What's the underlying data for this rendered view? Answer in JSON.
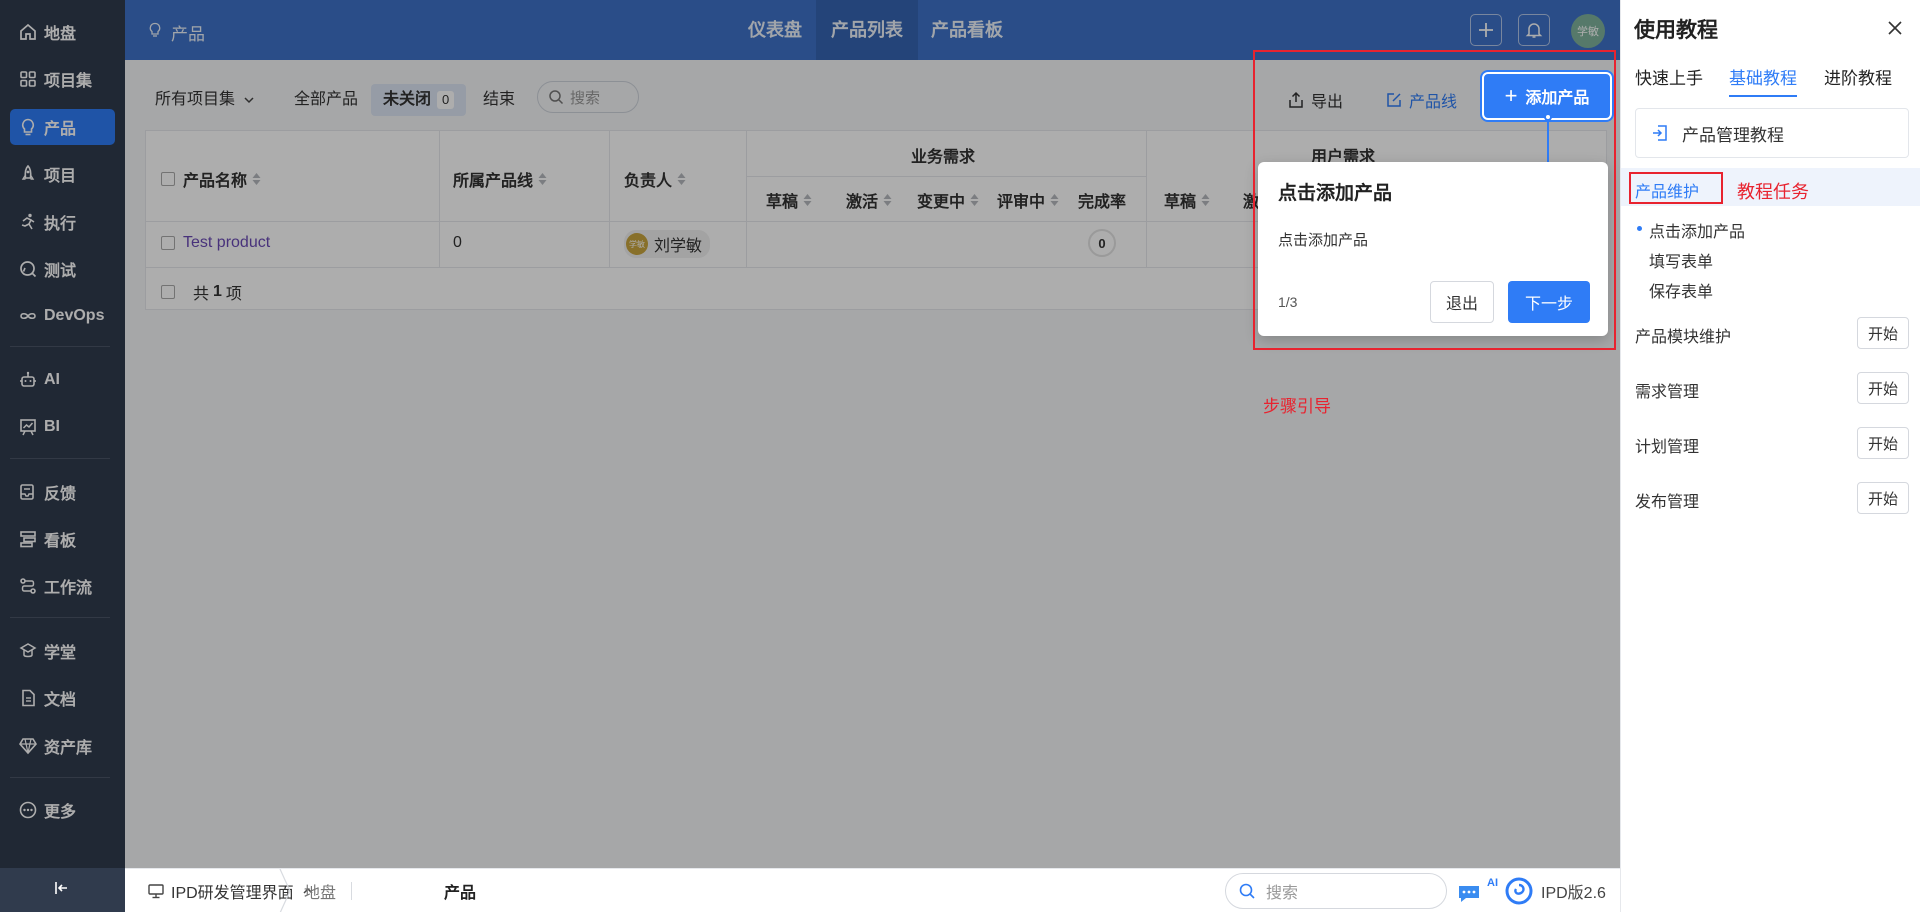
{
  "sidebar": {
    "items": [
      {
        "label": "地盘",
        "icon": "home-icon"
      },
      {
        "label": "项目集",
        "icon": "grid-icon"
      },
      {
        "label": "产品",
        "icon": "bulb-icon"
      },
      {
        "label": "项目",
        "icon": "rocket-icon"
      },
      {
        "label": "执行",
        "icon": "run-icon"
      },
      {
        "label": "测试",
        "icon": "test-icon"
      },
      {
        "label": "DevOps",
        "icon": "infinity-icon"
      },
      {
        "label": "AI",
        "icon": "robot-icon"
      },
      {
        "label": "BI",
        "icon": "chart-board-icon"
      },
      {
        "label": "反馈",
        "icon": "feedback-icon"
      },
      {
        "label": "看板",
        "icon": "kanban-icon"
      },
      {
        "label": "工作流",
        "icon": "workflow-icon"
      },
      {
        "label": "学堂",
        "icon": "school-icon"
      },
      {
        "label": "文档",
        "icon": "doc-icon"
      },
      {
        "label": "资产库",
        "icon": "diamond-icon"
      },
      {
        "label": "更多",
        "icon": "more-icon"
      }
    ]
  },
  "header": {
    "title": "产品",
    "tabs": [
      "仪表盘",
      "产品列表",
      "产品看板"
    ],
    "avatar": "学敏"
  },
  "filters": {
    "program_set": "所有项目集",
    "all": "全部产品",
    "unclosed": "未关闭",
    "unclosed_count": "0",
    "closed": "结束",
    "search": "搜索"
  },
  "actions": {
    "export": "导出",
    "product_line": "产品线",
    "add_product": "添加产品"
  },
  "table": {
    "headers": {
      "name": "产品名称",
      "line": "所属产品线",
      "owner": "负责人",
      "business_req": "业务需求",
      "user_req": "用户需求",
      "sub": [
        "草稿",
        "激活",
        "变更中",
        "评审中",
        "完成率"
      ],
      "user_sub_draft": "草稿",
      "user_sub_active": "激"
    },
    "rows": [
      {
        "name": "Test product",
        "line": "0",
        "owner": "刘学敏",
        "owner_avatar": "学敏",
        "rate": "0"
      }
    ],
    "total_prefix": "共",
    "total_count": "1",
    "total_suffix": "项"
  },
  "guide": {
    "title": "点击添加产品",
    "body": "点击添加产品",
    "step": "1/3",
    "exit": "退出",
    "next": "下一步"
  },
  "annotations": {
    "step_guide": "步骤引导",
    "tutorial_task": "教程任务"
  },
  "bottombar": {
    "workspace": "IPD研发管理界面",
    "crumb_home": "地盘",
    "crumb_current": "产品",
    "search": "搜索",
    "ai_badge": "AI",
    "version": "IPD版2.6"
  },
  "panel": {
    "title": "使用教程",
    "tabs": [
      "快速上手",
      "基础教程",
      "进阶教程"
    ],
    "course": "产品管理教程",
    "task": "产品维护",
    "steps": [
      "点击添加产品",
      "填写表单",
      "保存表单"
    ],
    "modules": [
      "产品模块维护",
      "需求管理",
      "计划管理",
      "发布管理"
    ],
    "start": "开始"
  },
  "colors": {
    "sidebar_bg": "#303b4d",
    "header_bg": "#3e72c9",
    "accent": "#2f7cf6",
    "annotation": "#e8232f"
  }
}
